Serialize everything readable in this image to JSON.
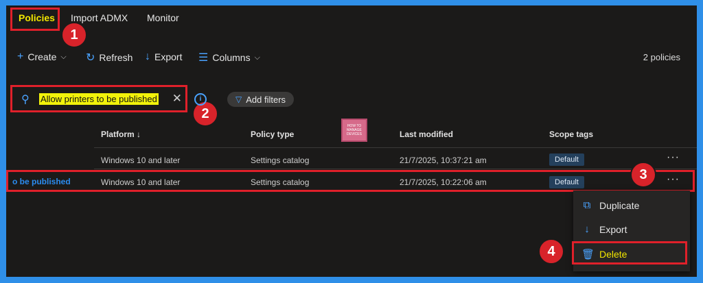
{
  "tabs": [
    {
      "label": "Policies"
    },
    {
      "label": "Import ADMX"
    },
    {
      "label": "Monitor"
    }
  ],
  "toolbar": {
    "create_label": "Create",
    "refresh_label": "Refresh",
    "export_label": "Export",
    "columns_label": "Columns",
    "count_label": "2 policies"
  },
  "search": {
    "value": "Allow printers to be published"
  },
  "filters": {
    "label": "Add filters"
  },
  "table": {
    "headers": [
      "Platform ↓",
      "Policy type",
      "Last modified",
      "Scope tags"
    ],
    "rows": [
      {
        "name": "",
        "platform": "Windows 10 and later",
        "type": "Settings catalog",
        "modified": "21/7/2025, 10:37:21 am",
        "tag": "Default"
      },
      {
        "name": "o be published",
        "platform": "Windows 10 and later",
        "type": "Settings catalog",
        "modified": "21/7/2025, 10:22:06 am",
        "tag": "Default"
      }
    ]
  },
  "menu": {
    "items": [
      {
        "label": "Duplicate",
        "icon": "duplicate-icon"
      },
      {
        "label": "Export",
        "icon": "download-icon"
      },
      {
        "label": "Delete",
        "icon": "trash-icon"
      }
    ]
  },
  "annotations": [
    "1",
    "2",
    "3",
    "4"
  ],
  "logo": {
    "text_top": "HOW TO",
    "text_mid": "MANAGE",
    "text_bot": "DEVICES"
  },
  "colors": {
    "accent": "#4aa3ff",
    "highlight": "#f2e600",
    "annotation": "#d8232a"
  }
}
